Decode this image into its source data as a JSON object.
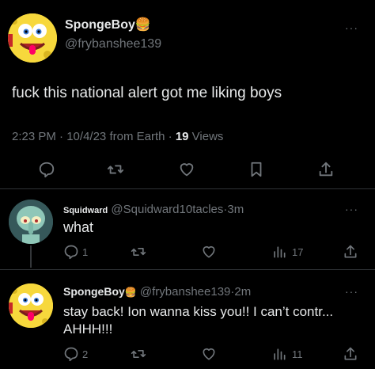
{
  "main_tweet": {
    "display_name": "SpongeBoy",
    "name_emoji": "🍔",
    "handle": "@frybanshee139",
    "text": "fuck this national alert got me liking boys",
    "time": "2:23 PM",
    "date": "10/4/23",
    "source": "from Earth",
    "views_count": "19",
    "views_label": "Views",
    "sep": "·",
    "more": "···"
  },
  "replies": [
    {
      "display_name": "Squidward",
      "handle": "@Squidward10tacles",
      "sep": "·",
      "age": "3m",
      "text": "what",
      "reply_count": "1",
      "retweet_count": "",
      "like_count": "",
      "views_count": "17",
      "more": "···"
    },
    {
      "display_name": "SpongeBoy",
      "name_emoji": "🍔",
      "handle": "@frybanshee139",
      "sep": "·",
      "age": "2m",
      "text_line1": "stay back! Ion wanna kiss  you!! I can’t contr...",
      "text_line2": "AHHH!!!",
      "reply_count": "2",
      "retweet_count": "",
      "like_count": "",
      "views_count": "11",
      "more": "···"
    }
  ],
  "icons": {
    "reply": "reply-icon",
    "retweet": "retweet-icon",
    "like": "heart-icon",
    "bookmark": "bookmark-icon",
    "share": "share-icon",
    "views": "views-icon"
  },
  "colors": {
    "background": "#000000",
    "text": "#e7e9ea",
    "muted": "#71767b",
    "divider": "#2f3336"
  }
}
